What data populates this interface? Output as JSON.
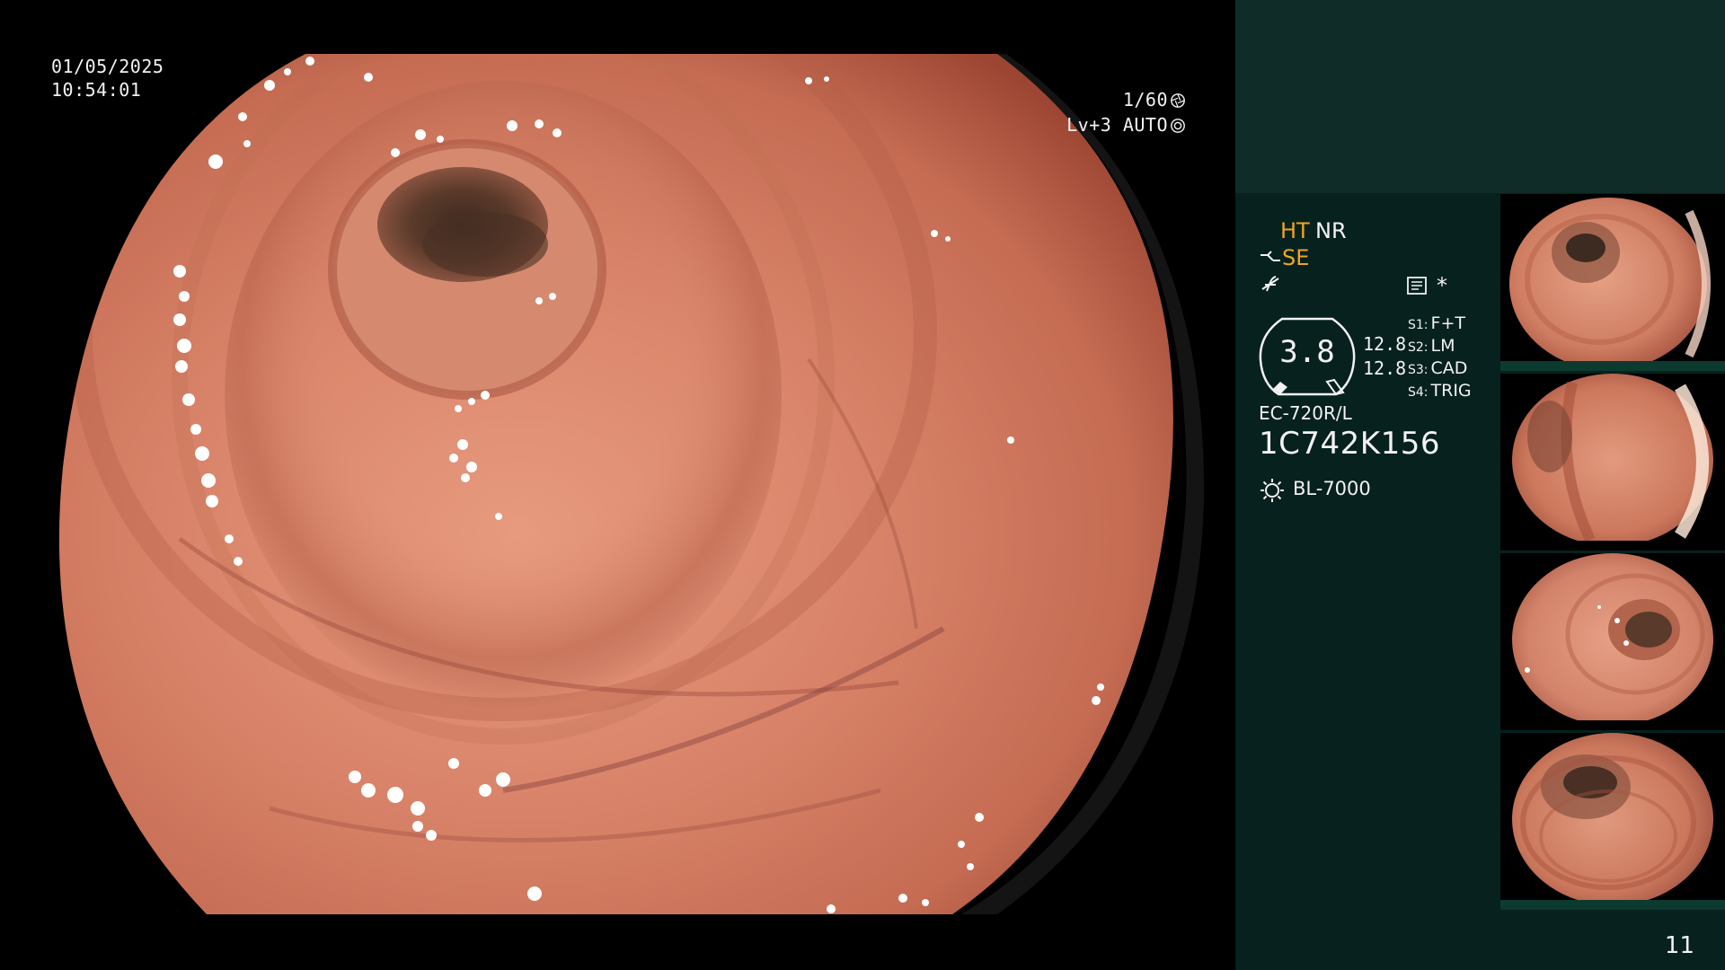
{
  "overlay": {
    "date": "01/05/2025",
    "time": "10:54:01",
    "shutter": "1/60",
    "level": "Lv+3 AUTO"
  },
  "panel": {
    "mode_ht": "HT",
    "mode_nr": "NR",
    "mode_se": "SE",
    "star": "*",
    "gauge_value": "3.8",
    "gauge_readouts": [
      "12.8",
      "12.8"
    ],
    "slots": [
      {
        "key": "S1:",
        "value": "F+T"
      },
      {
        "key": "S2:",
        "value": "LM"
      },
      {
        "key": "S3:",
        "value": "CAD"
      },
      {
        "key": "S4:",
        "value": "TRIG"
      }
    ],
    "scope_model": "EC-720R/L",
    "scope_serial": "1C742K156",
    "light_source": "BL-7000",
    "page_number": "11"
  },
  "icons": {
    "shutter": "shutter-icon",
    "iris": "iris-icon",
    "scope_sensor": "scope-sensor-icon",
    "freeze": "freeze-icon",
    "memory": "memory-icon",
    "light": "light-source-icon"
  },
  "colors": {
    "mucosa": "#d97e63",
    "mucosa_dark": "#a8503a",
    "mode_active": "#f2a51f",
    "panel_bg": "#07201d",
    "panel_top": "#0f2c28"
  },
  "thumbnails": [
    {
      "label": "captured-image-1"
    },
    {
      "label": "captured-image-2"
    },
    {
      "label": "captured-image-3"
    },
    {
      "label": "captured-image-4"
    }
  ]
}
